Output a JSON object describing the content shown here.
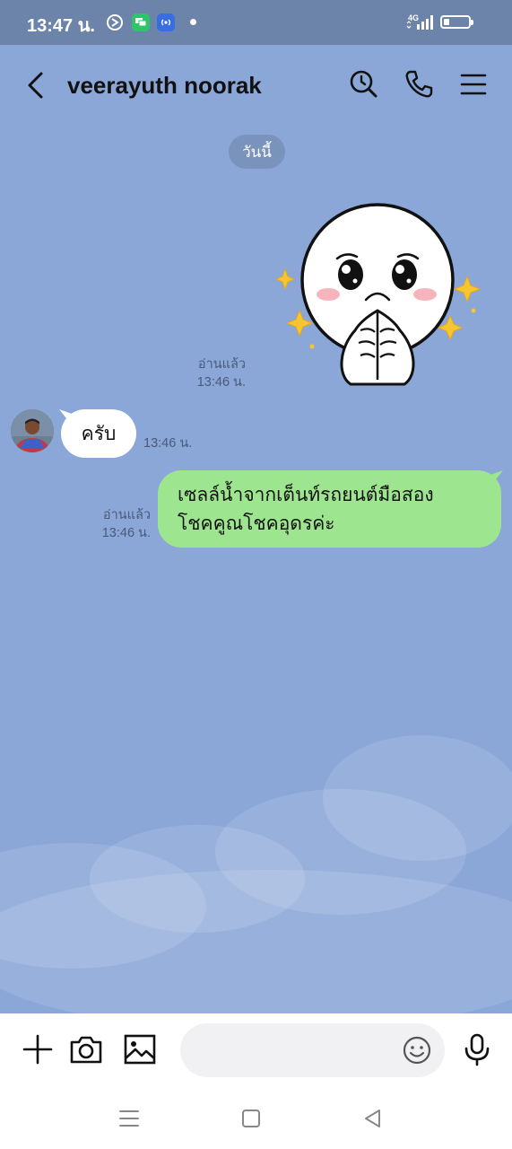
{
  "status_bar": {
    "time": "13:47 น.",
    "network_label": "4G",
    "battery_percent": 25,
    "icons": [
      "media-cast-icon",
      "chat-notification-icon",
      "hotspot-icon",
      "notification-dot",
      "signal-icon",
      "battery-icon"
    ]
  },
  "header": {
    "title": "veerayuth noorak",
    "icons": [
      "back-arrow-icon",
      "search-icon",
      "phone-icon",
      "menu-icon"
    ]
  },
  "chat": {
    "date_label": "วันนี้",
    "messages": [
      {
        "direction": "outgoing",
        "type": "sticker",
        "sticker": "crying-white-face-sticker",
        "read_label": "อ่านแล้ว",
        "time": "13:46 น."
      },
      {
        "direction": "incoming",
        "type": "text",
        "text": "ครับ",
        "time": "13:46 น."
      },
      {
        "direction": "outgoing",
        "type": "text",
        "lines": [
          "เซลล์น้ำจากเต็นท์รถยนต์มือสอง",
          "โชคคูณโชคอุดรค่ะ"
        ],
        "read_label": "อ่านแล้ว",
        "time": "13:46 น."
      }
    ]
  },
  "input_bar": {
    "value": "",
    "icons": [
      "plus-icon",
      "camera-icon",
      "image-icon",
      "emoji-icon",
      "microphone-icon"
    ]
  },
  "nav_bar": {
    "icons": [
      "recent-apps-icon",
      "home-icon",
      "back-icon"
    ]
  },
  "colors": {
    "chat_background": "#8aa7d8",
    "outgoing_bubble": "#9ee58f",
    "incoming_bubble": "#ffffff",
    "status_bar": "#6c83aa"
  }
}
